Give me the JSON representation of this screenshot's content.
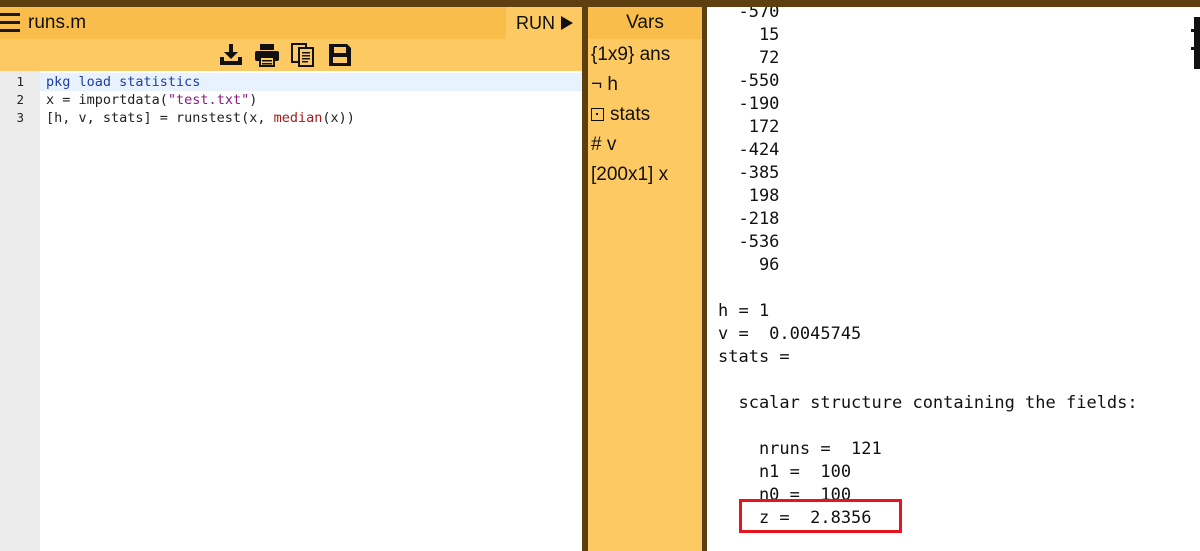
{
  "editor": {
    "file_name": "runs.m",
    "run_label": "RUN",
    "toolbar_icons": [
      "import-icon",
      "print-icon",
      "copy-icon",
      "save-icon"
    ],
    "line_numbers": [
      "1",
      "2",
      "3"
    ],
    "code": {
      "line1": {
        "kw": "pkg load statistics"
      },
      "line2": {
        "a": "x = importdata(",
        "s": "\"test.txt\"",
        "b": ")"
      },
      "line3": {
        "a": "[h, v, stats] = runstest(x, ",
        "f": "median",
        "b": "(x))"
      }
    }
  },
  "vars": {
    "title": "Vars",
    "items": [
      {
        "type": "{1x9}",
        "name": "ans"
      },
      {
        "type": "¬",
        "name": "h"
      },
      {
        "type": "",
        "name": "stats"
      },
      {
        "type": "#",
        "name": "v"
      },
      {
        "type": "[200x1]",
        "name": "x"
      }
    ]
  },
  "output": {
    "lines": [
      "  -570",
      "    15",
      "    72",
      "  -550",
      "  -190",
      "   172",
      "  -424",
      "  -385",
      "   198",
      "  -218",
      "  -536",
      "    96",
      "",
      "h = 1",
      "v =  0.0045745",
      "stats =",
      "",
      "  scalar structure containing the fields:",
      "",
      "    nruns =  121",
      "    n1 =  100",
      "    n0 =  100",
      "    z =  2.8356"
    ]
  },
  "colors": {
    "header": "#f8bd4a",
    "toolbar": "#fcc962",
    "border": "#5e3f10",
    "highlight": "#e8141b"
  }
}
